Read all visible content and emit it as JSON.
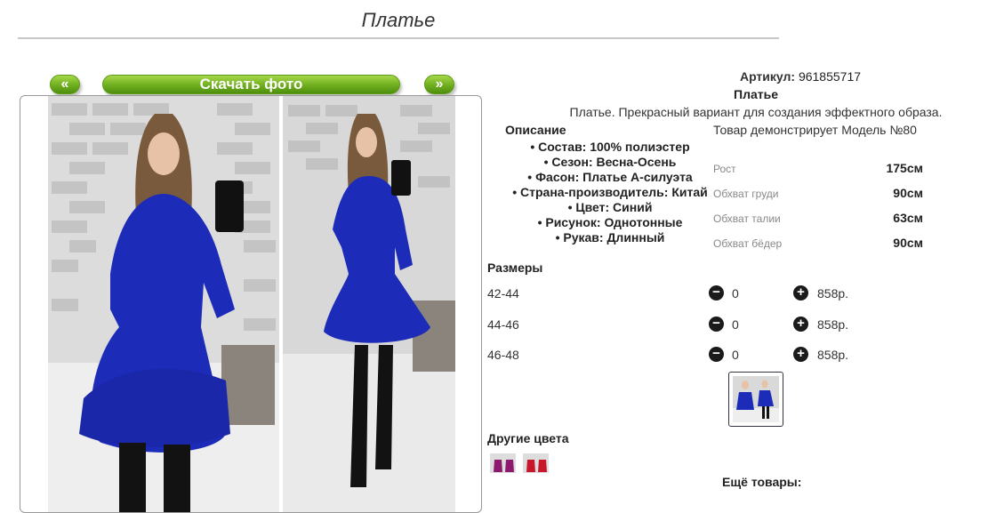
{
  "page": {
    "title": "Платье"
  },
  "gallery": {
    "prev_label": "«",
    "next_label": "»",
    "download_label": "Скачать фото"
  },
  "product": {
    "article_label": "Артикул:",
    "article_value": "961855717",
    "name": "Платье",
    "description": "Платье. Прекрасный вариант для создания эффектного образа."
  },
  "details": {
    "heading": "Описание",
    "attributes": [
      "Состав: 100% полиэстер",
      "Сезон: Весна-Осень",
      "Фасон: Платье А-силуэта",
      "Страна-производитель: Китай",
      "Цвет: Синий",
      "Рисунок: Однотонные",
      "Рукав: Длинный"
    ]
  },
  "model": {
    "title": "Товар демонстрирует Модель №80",
    "measurements": [
      {
        "label": "Рост",
        "value": "175см"
      },
      {
        "label": "Обхват груди",
        "value": "90см"
      },
      {
        "label": "Обхват талии",
        "value": "63см"
      },
      {
        "label": "Обхват бёдер",
        "value": "90см"
      }
    ]
  },
  "sizes": {
    "heading": "Размеры",
    "minus_symbol": "−",
    "plus_symbol": "+",
    "rows": [
      {
        "size": "42-44",
        "qty": "0",
        "price": "858р."
      },
      {
        "size": "44-46",
        "qty": "0",
        "price": "858р."
      },
      {
        "size": "46-48",
        "qty": "0",
        "price": "858р."
      }
    ]
  },
  "other_colors": {
    "heading": "Другие цвета"
  },
  "more_goods": {
    "heading": "Ещё товары:"
  },
  "colors": {
    "accent_green": "#6fae1e",
    "dress_blue": "#1c2bb8",
    "text_dark": "#222222",
    "muted_label": "#888888"
  }
}
